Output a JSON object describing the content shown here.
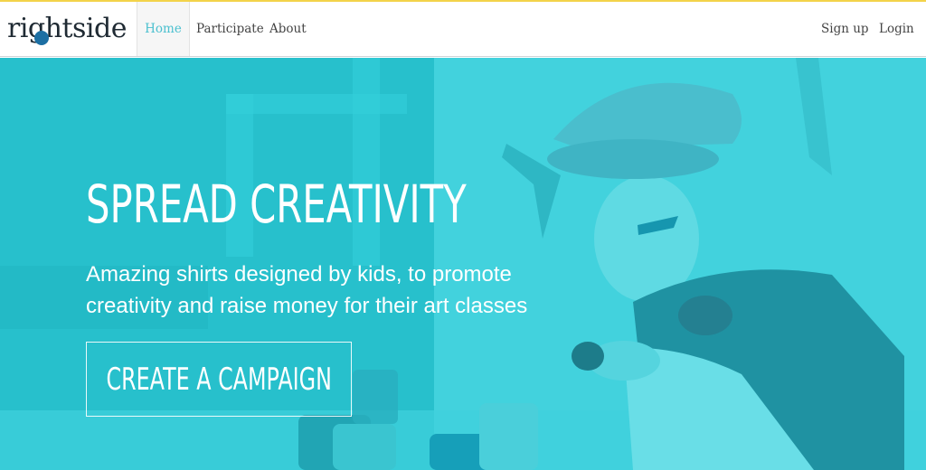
{
  "header": {
    "brand": "rightside",
    "nav": [
      {
        "label": "Home"
      },
      {
        "label": "Participate"
      },
      {
        "label": "About"
      }
    ],
    "account": {
      "signup": "Sign up",
      "login": "Login"
    }
  },
  "hero": {
    "title": "SPREAD CREATIVITY",
    "subtitle": "Amazing shirts designed by kids, to promote creativity and raise money for their art classes",
    "cta": "CREATE A CAMPAIGN"
  },
  "colors": {
    "accent": "#4bc0cf",
    "hero_tint": "#2cc9d6",
    "top_bar": "#f3d34a"
  }
}
